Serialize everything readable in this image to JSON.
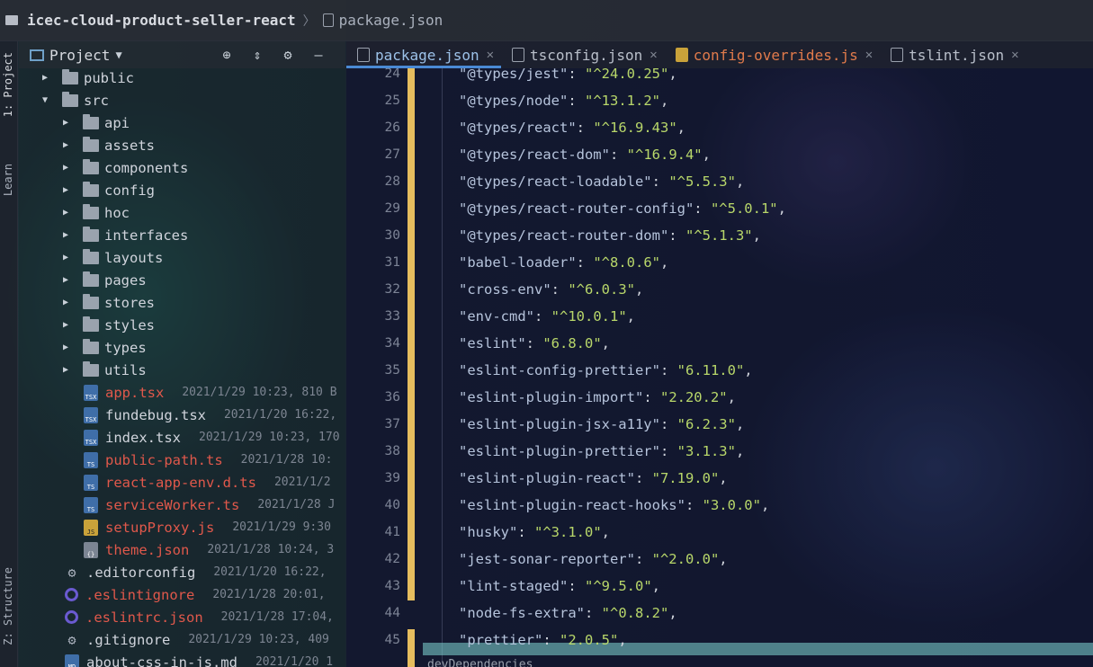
{
  "breadcrumb": {
    "project": "icec-cloud-product-seller-react",
    "file": "package.json"
  },
  "left_strip": {
    "tabs": [
      "1: Project",
      "Learn",
      "Z: Structure"
    ]
  },
  "project_panel": {
    "title": "Project",
    "tree": [
      {
        "name": "public",
        "type": "folder",
        "level": 1,
        "expanded": false
      },
      {
        "name": "src",
        "type": "folder",
        "level": 1,
        "expanded": true
      },
      {
        "name": "api",
        "type": "folder",
        "level": 2,
        "expanded": false
      },
      {
        "name": "assets",
        "type": "folder",
        "level": 2,
        "expanded": false
      },
      {
        "name": "components",
        "type": "folder",
        "level": 2,
        "expanded": false
      },
      {
        "name": "config",
        "type": "folder",
        "level": 2,
        "expanded": false
      },
      {
        "name": "hoc",
        "type": "folder",
        "level": 2,
        "expanded": false
      },
      {
        "name": "interfaces",
        "type": "folder",
        "level": 2,
        "expanded": false
      },
      {
        "name": "layouts",
        "type": "folder",
        "level": 2,
        "expanded": false
      },
      {
        "name": "pages",
        "type": "folder",
        "level": 2,
        "expanded": false
      },
      {
        "name": "stores",
        "type": "folder",
        "level": 2,
        "expanded": false
      },
      {
        "name": "styles",
        "type": "folder",
        "level": 2,
        "expanded": false
      },
      {
        "name": "types",
        "type": "folder",
        "level": 2,
        "expanded": false
      },
      {
        "name": "utils",
        "type": "folder",
        "level": 2,
        "expanded": false
      },
      {
        "name": "app.tsx",
        "type": "tsx",
        "level": 2,
        "red": true,
        "meta": "2021/1/29 10:23, 810 B"
      },
      {
        "name": "fundebug.tsx",
        "type": "tsx",
        "level": 2,
        "red": false,
        "meta": "2021/1/20 16:22,"
      },
      {
        "name": "index.tsx",
        "type": "tsx",
        "level": 2,
        "red": false,
        "meta": "2021/1/29 10:23, 170"
      },
      {
        "name": "public-path.ts",
        "type": "ts",
        "level": 2,
        "red": true,
        "meta": "2021/1/28 10:"
      },
      {
        "name": "react-app-env.d.ts",
        "type": "ts",
        "level": 2,
        "red": true,
        "meta": "2021/1/2"
      },
      {
        "name": "serviceWorker.ts",
        "type": "ts",
        "level": 2,
        "red": true,
        "meta": "2021/1/28 J"
      },
      {
        "name": "setupProxy.js",
        "type": "js",
        "level": 2,
        "red": true,
        "meta": "2021/1/29 9:30"
      },
      {
        "name": "theme.json",
        "type": "json",
        "level": 2,
        "red": true,
        "meta": "2021/1/28 10:24, 3"
      },
      {
        "name": ".editorconfig",
        "type": "cfg",
        "level": 1,
        "red": false,
        "meta": "2021/1/20 16:22,"
      },
      {
        "name": ".eslintignore",
        "type": "ring",
        "level": 1,
        "red": true,
        "meta": "2021/1/28 20:01,"
      },
      {
        "name": ".eslintrc.json",
        "type": "ring",
        "level": 1,
        "red": true,
        "meta": "2021/1/28 17:04,"
      },
      {
        "name": ".gitignore",
        "type": "cfg",
        "level": 1,
        "red": false,
        "meta": "2021/1/29 10:23, 409"
      },
      {
        "name": "about-css-in-js.md",
        "type": "md",
        "level": 1,
        "red": false,
        "meta": "2021/1/20 1"
      }
    ]
  },
  "tabs": [
    {
      "label": "package.json",
      "active": true,
      "icon": "json"
    },
    {
      "label": "tsconfig.json",
      "active": false,
      "icon": "json"
    },
    {
      "label": "config-overrides.js",
      "active": false,
      "icon": "js",
      "modified": true
    },
    {
      "label": "tslint.json",
      "active": false,
      "icon": "json"
    }
  ],
  "editor": {
    "lines": [
      {
        "num": "24",
        "key": "\"@types/jest\"",
        "val": "\"^24.0.25\""
      },
      {
        "num": "25",
        "key": "\"@types/node\"",
        "val": "\"^13.1.2\""
      },
      {
        "num": "26",
        "key": "\"@types/react\"",
        "val": "\"^16.9.43\""
      },
      {
        "num": "27",
        "key": "\"@types/react-dom\"",
        "val": "\"^16.9.4\""
      },
      {
        "num": "28",
        "key": "\"@types/react-loadable\"",
        "val": "\"^5.5.3\""
      },
      {
        "num": "29",
        "key": "\"@types/react-router-config\"",
        "val": "\"^5.0.1\""
      },
      {
        "num": "30",
        "key": "\"@types/react-router-dom\"",
        "val": "\"^5.1.3\""
      },
      {
        "num": "31",
        "key": "\"babel-loader\"",
        "val": "\"^8.0.6\""
      },
      {
        "num": "32",
        "key": "\"cross-env\"",
        "val": "\"^6.0.3\""
      },
      {
        "num": "33",
        "key": "\"env-cmd\"",
        "val": "\"^10.0.1\""
      },
      {
        "num": "34",
        "key": "\"eslint\"",
        "val": "\"6.8.0\""
      },
      {
        "num": "35",
        "key": "\"eslint-config-prettier\"",
        "val": "\"6.11.0\""
      },
      {
        "num": "36",
        "key": "\"eslint-plugin-import\"",
        "val": "\"2.20.2\""
      },
      {
        "num": "37",
        "key": "\"eslint-plugin-jsx-a11y\"",
        "val": "\"6.2.3\""
      },
      {
        "num": "38",
        "key": "\"eslint-plugin-prettier\"",
        "val": "\"3.1.3\""
      },
      {
        "num": "39",
        "key": "\"eslint-plugin-react\"",
        "val": "\"7.19.0\""
      },
      {
        "num": "40",
        "key": "\"eslint-plugin-react-hooks\"",
        "val": "\"3.0.0\""
      },
      {
        "num": "41",
        "key": "\"husky\"",
        "val": "\"^3.1.0\""
      },
      {
        "num": "42",
        "key": "\"jest-sonar-reporter\"",
        "val": "\"^2.0.0\""
      },
      {
        "num": "43",
        "key": "\"lint-staged\"",
        "val": "\"^9.5.0\""
      },
      {
        "num": "44",
        "key": "\"node-fs-extra\"",
        "val": "\"^0.8.2\""
      },
      {
        "num": "45",
        "key": "\"prettier\"",
        "val": "\"2.0.5\""
      }
    ],
    "bottom_breadcrumb": "devDependencies"
  },
  "colors": {
    "modified_file": "#e0584b",
    "active_tab": "#9cc1e8",
    "change_marker": "#e6bd5e",
    "string": "#b8d76a"
  }
}
